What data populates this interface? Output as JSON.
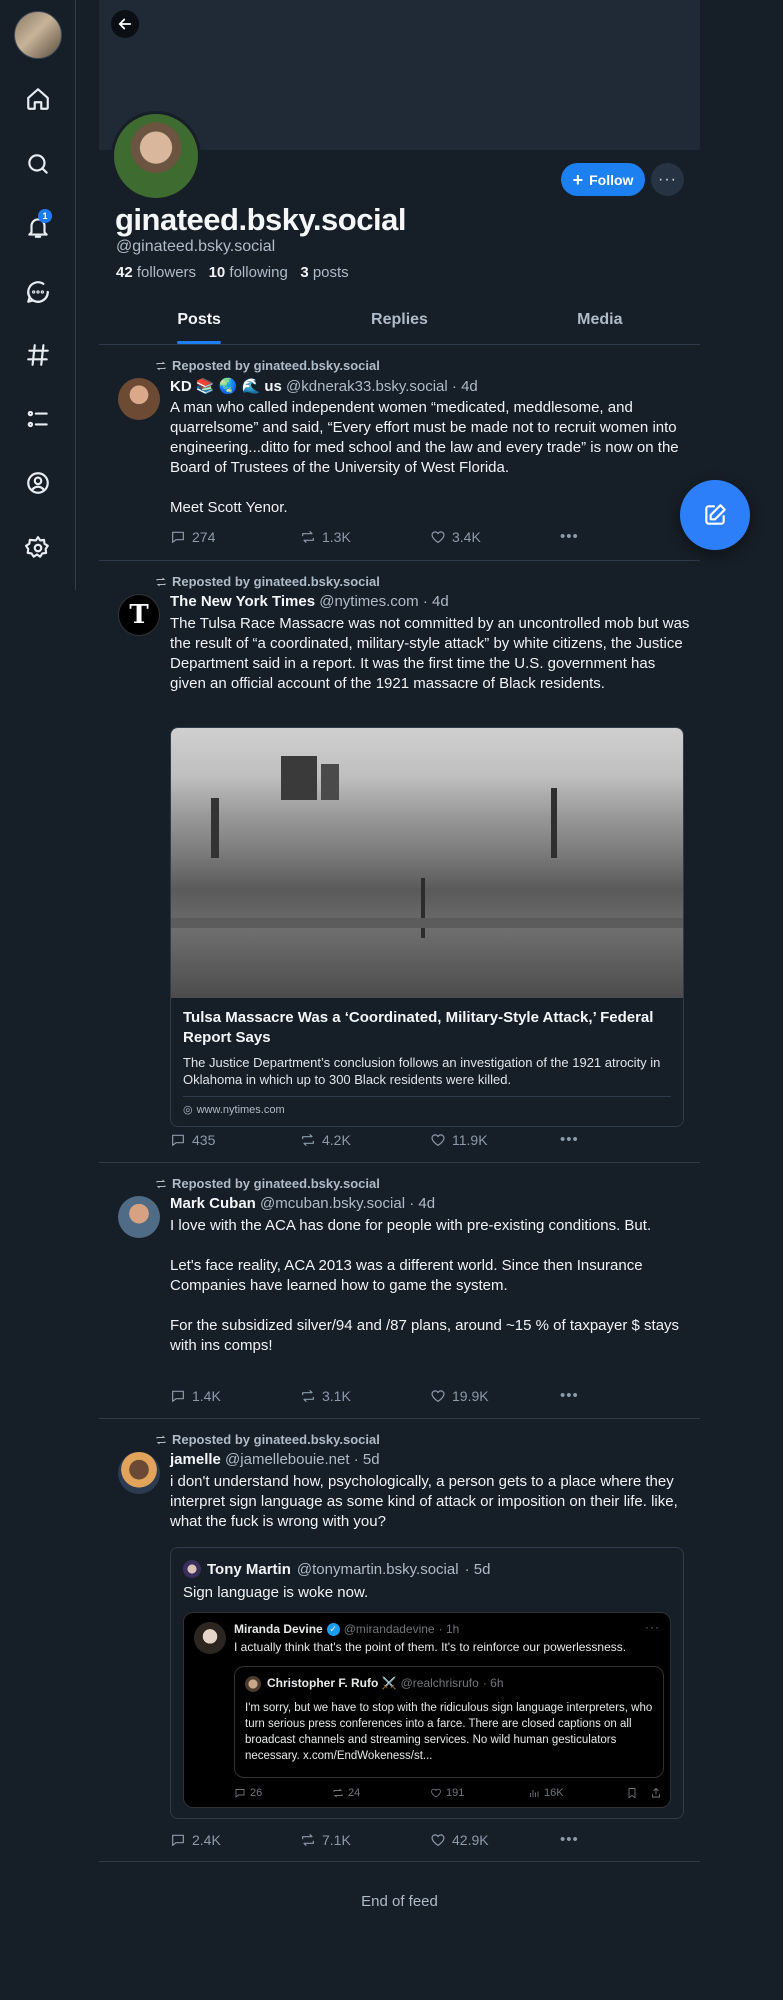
{
  "profile": {
    "display_name": "ginateed.bsky.social",
    "handle": "@ginateed.bsky.social",
    "followers_count": "42",
    "followers_label": "followers",
    "following_count": "10",
    "following_label": "following",
    "posts_count": "3",
    "posts_label": "posts",
    "follow_label": "Follow",
    "more_label": "···"
  },
  "nav": {
    "icons": [
      "home-icon",
      "search-icon",
      "bell-icon",
      "chat-icon",
      "hashtag-icon",
      "list-icon",
      "profile-icon",
      "gear-icon"
    ],
    "notification_badge": "1",
    "accent": "#1d80f0"
  },
  "tabs": [
    {
      "label": "Posts",
      "active": true
    },
    {
      "label": "Replies",
      "active": false
    },
    {
      "label": "Media",
      "active": false
    }
  ],
  "posts": [
    {
      "repost_by": "Reposted by ginateed.bsky.social",
      "name": "KD 📚 🌏 🌊 us",
      "handle": "@kdnerak33.bsky.social",
      "time": "· 4d",
      "text": "A man who called independent women “medicated, meddlesome, and quarrelsome” and said, “Every effort must be made not to recruit women into engineering...ditto for med school and the law and every trade” is now on the Board of Trustees of the University of West Florida.\n\nMeet Scott Yenor.",
      "replies": "274",
      "reposts": "1.3K",
      "likes": "3.4K"
    },
    {
      "repost_by": "Reposted by ginateed.bsky.social",
      "name": "The New York Times",
      "handle": "@nytimes.com",
      "time": "· 4d",
      "text": "The Tulsa Race Massacre was not committed by an uncontrolled mob but was the result of “a coordinated, military-style attack” by white citizens, the Justice Department said in a report. It was the first time the U.S. government has given an official account of the 1921 massacre of Black residents.",
      "card": {
        "title": "Tulsa Massacre Was a ‘Coordinated, Military-Style Attack,’ Federal Report Says",
        "description": "The Justice Department’s conclusion follows an investigation of the 1921 atrocity in Oklahoma in which up to 300 Black residents were killed.",
        "domain": "www.nytimes.com"
      },
      "replies": "435",
      "reposts": "4.2K",
      "likes": "11.9K"
    },
    {
      "repost_by": "Reposted by ginateed.bsky.social",
      "name": "Mark Cuban",
      "handle": "@mcuban.bsky.social",
      "time": "· 4d",
      "text": "I love with the ACA has done for people with pre-existing conditions. But.\n\nLet's face reality, ACA 2013 was a different world.  Since then Insurance Companies have learned how to game the system.\n\nFor the subsidized silver/94 and /87 plans, around ~15 % of taxpayer $ stays with ins comps!",
      "replies": "1.4K",
      "reposts": "3.1K",
      "likes": "19.9K"
    },
    {
      "repost_by": "Reposted by ginateed.bsky.social",
      "name": "jamelle",
      "handle": "@jamellebouie.net",
      "time": "· 5d",
      "text": "i don't understand how, psychologically, a person gets to a place where they interpret sign language as some kind of attack or imposition on their life. like, what the fuck is wrong with you?",
      "quote": {
        "name": "Tony Martin",
        "handle": "@tonymartin.bsky.social",
        "time": "· 5d",
        "text": "Sign language is woke now.",
        "tweet": {
          "name": "Miranda Devine",
          "handle": "@mirandadevine",
          "time": "· 1h",
          "text": "I actually think that's the point of them. It's to reinforce our powerlessness.",
          "inner_name": "Christopher F. Rufo ⚔️",
          "inner_handle": "@realchrisrufo",
          "inner_time": "· 6h",
          "inner_text": "I'm sorry, but we have to stop with the ridiculous sign language interpreters, who turn serious press conferences into a farce. There are closed captions on all broadcast channels and streaming services. No wild human gesticulators necessary. x.com/EndWokeness/st...",
          "replies": "26",
          "reposts": "24",
          "likes": "191",
          "views": "16K"
        }
      },
      "replies": "2.4K",
      "reposts": "7.1K",
      "likes": "42.9K"
    }
  ],
  "feed_end": "End of feed"
}
